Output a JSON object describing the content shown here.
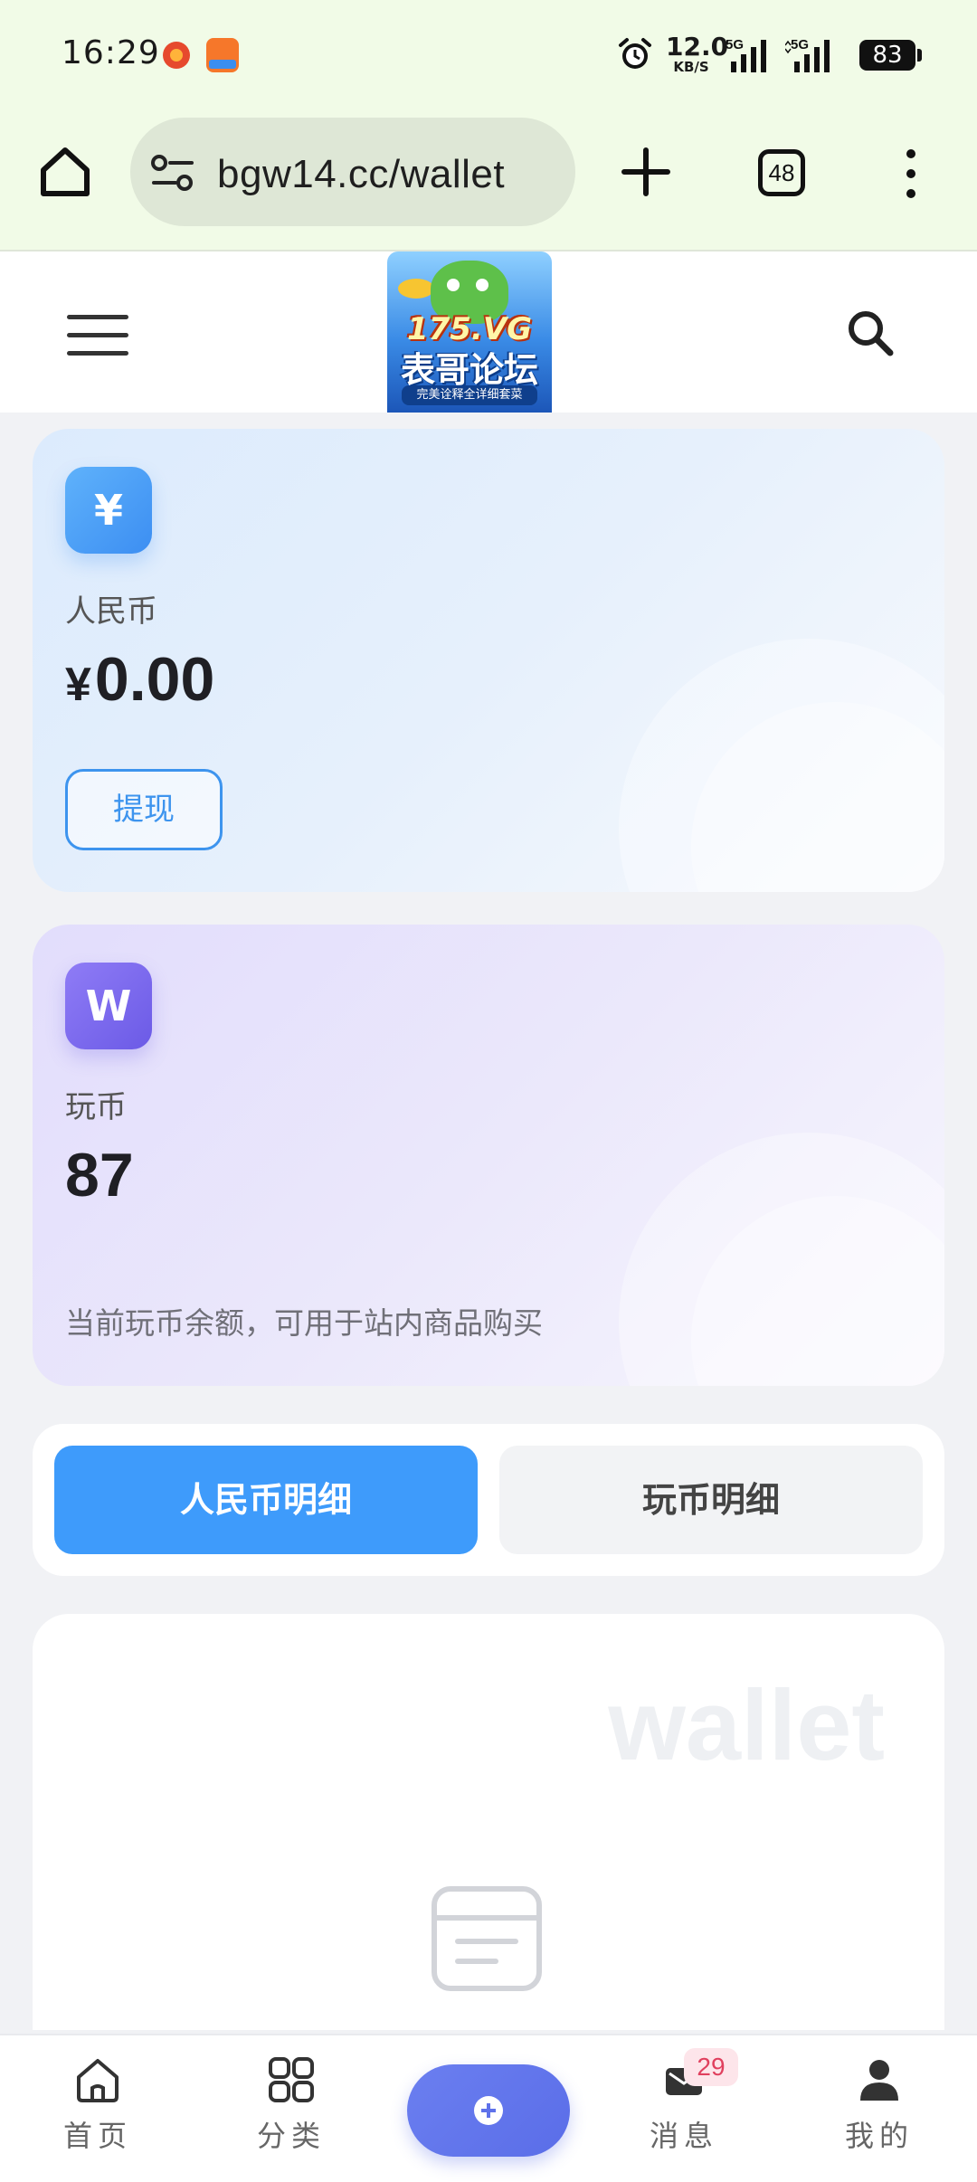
{
  "status_bar": {
    "time": "16:29",
    "net_speed_value": "12.0",
    "net_speed_unit": "KB/S",
    "signal1_label": "5G",
    "signal2_label": "5G",
    "battery": "83"
  },
  "browser": {
    "url": "bgw14.cc/wallet",
    "tab_count": "48"
  },
  "site_header": {
    "logo_line1": "175.VG",
    "logo_line2": "表哥论坛",
    "logo_line3": "完美诠释全详细套菜"
  },
  "rmb_card": {
    "icon_glyph": "¥",
    "label": "人民币",
    "currency_symbol": "¥",
    "amount": "0.00",
    "withdraw_label": "提现",
    "accent": "#3d94ee"
  },
  "coin_card": {
    "icon_glyph": "W",
    "label": "玩币",
    "amount": "87",
    "description": "当前玩币余额，可用于站内商品购买",
    "accent": "#6b5ae6"
  },
  "tabs": [
    {
      "label": "人民币明细",
      "active": true
    },
    {
      "label": "玩币明细",
      "active": false
    }
  ],
  "detail_panel": {
    "watermark": "wallet"
  },
  "bottom_nav": {
    "home_label": "首页",
    "category_label": "分类",
    "message_label": "消息",
    "message_badge": "29",
    "me_label": "我的"
  },
  "colors": {
    "status_bar_bg": "#f1fbe7",
    "active_tab": "#3e9bfb",
    "plus_button": "#5f72ea"
  }
}
